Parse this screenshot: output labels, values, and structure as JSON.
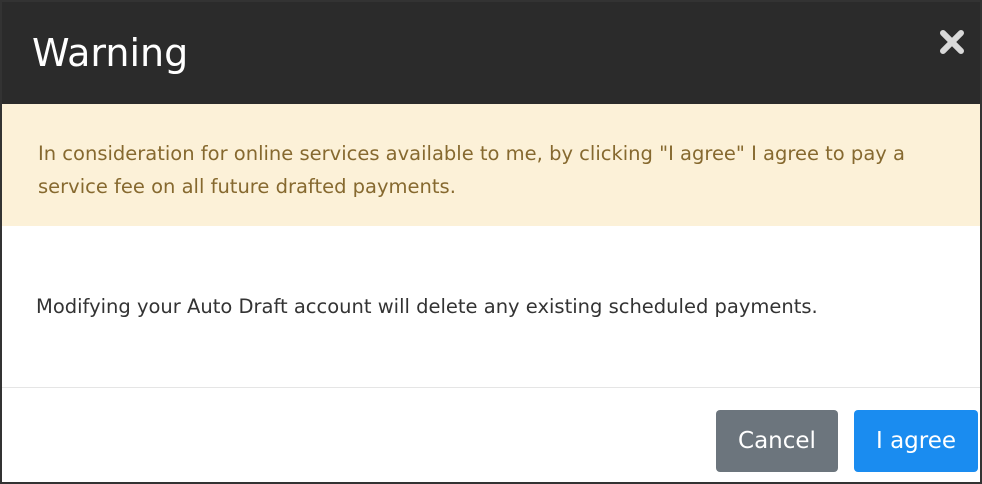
{
  "dialog": {
    "title": "Warning",
    "close_icon": "close-icon",
    "warning_message": "In consideration for online services available to me, by clicking \"I agree\" I agree to pay a service fee on all future drafted payments.",
    "body_message": "Modifying your Auto Draft account will delete any existing scheduled payments.",
    "buttons": {
      "cancel_label": "Cancel",
      "agree_label": "I agree"
    }
  },
  "colors": {
    "header_background": "#2b2b2b",
    "warning_background": "#fcf1d8",
    "warning_text": "#86692f",
    "cancel_button": "#6c757d",
    "agree_button": "#1a8cf0"
  }
}
